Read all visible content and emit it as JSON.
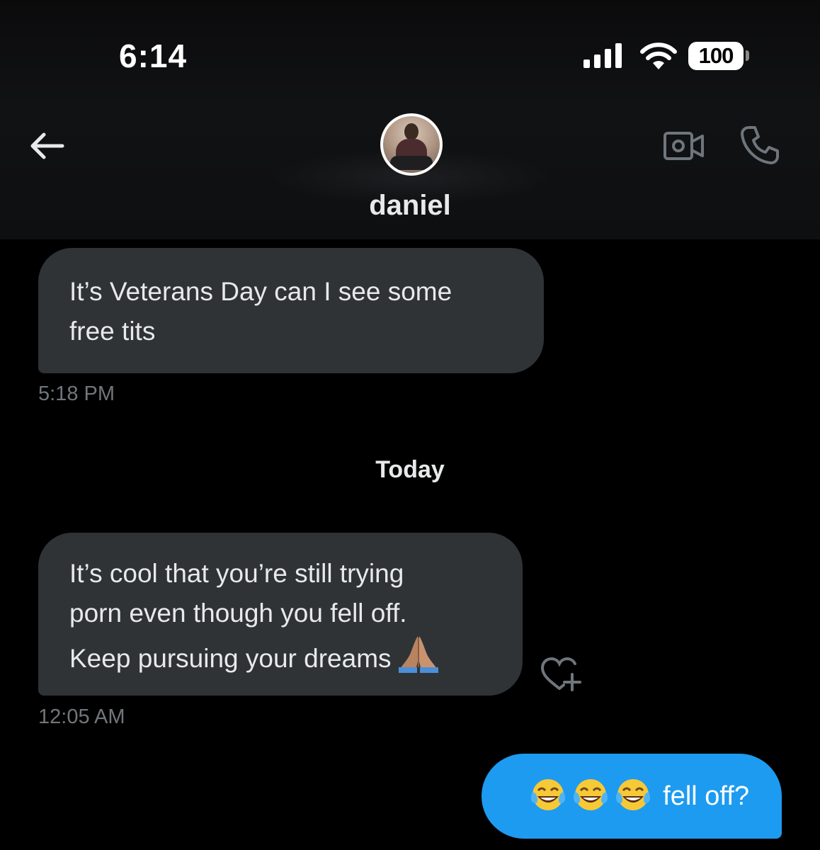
{
  "status_bar": {
    "time": "6:14",
    "battery": "100"
  },
  "header": {
    "contact_name": "daniel",
    "back_icon": "arrow-left-icon",
    "video_icon": "video-camera-icon",
    "call_icon": "phone-icon"
  },
  "messages": [
    {
      "direction": "incoming",
      "lines": [
        "It’s Veterans Day can I see some",
        "free tits"
      ],
      "timestamp": "5:18 PM"
    },
    {
      "direction": "incoming",
      "lines": [
        "It’s cool that you’re still trying",
        "porn even though you fell off.",
        "Keep pursuing your dreams"
      ],
      "emoji": "folded-hands-icon",
      "timestamp": "12:05 AM"
    },
    {
      "direction": "outgoing",
      "emojis": [
        "tears-of-joy-icon",
        "tears-of-joy-icon",
        "tears-of-joy-icon"
      ],
      "text": "fell off?"
    }
  ],
  "day_divider": "Today",
  "colors": {
    "background": "#000000",
    "incoming_bubble": "#2f3336",
    "outgoing_bubble": "#1d9bf0",
    "timestamp": "#71767b"
  }
}
